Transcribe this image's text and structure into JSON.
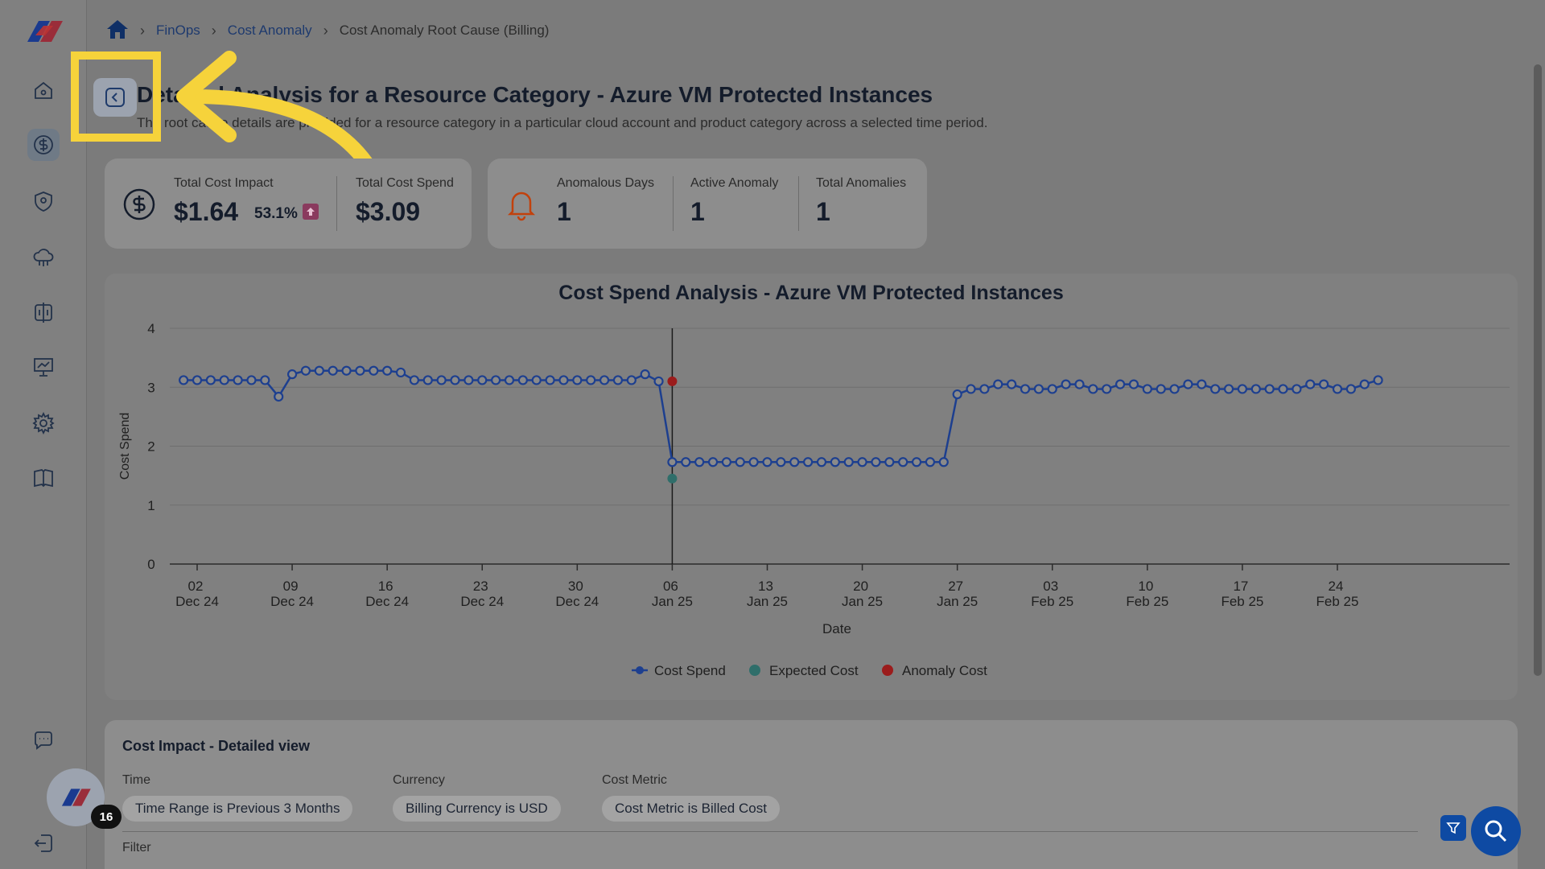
{
  "breadcrumb": {
    "items": [
      "FinOps",
      "Cost Anomaly"
    ],
    "current": "Cost Anomaly Root Cause (Billing)"
  },
  "header": {
    "title": "Detailed Analysis for a Resource Category - Azure VM Protected Instances",
    "subtitle": "The root cause details are provided for a resource category in a particular cloud account and product category across a selected time period."
  },
  "kpis": {
    "total_cost_impact_label": "Total Cost Impact",
    "total_cost_impact_value": "$1.64",
    "impact_percent": "53.1%",
    "total_cost_spend_label": "Total Cost Spend",
    "total_cost_spend_value": "$3.09",
    "anomalous_days_label": "Anomalous Days",
    "anomalous_days_value": "1",
    "active_anomaly_label": "Active Anomaly",
    "active_anomaly_value": "1",
    "total_anomalies_label": "Total Anomalies",
    "total_anomalies_value": "1"
  },
  "chart_data": {
    "type": "line",
    "title": "Cost Spend Analysis - Azure VM Protected Instances",
    "xlabel": "Date",
    "ylabel": "Cost Spend",
    "ylim": [
      0,
      4
    ],
    "yticks": [
      0,
      1,
      2,
      3,
      4
    ],
    "xticks": [
      {
        "day": 0,
        "l1": "02",
        "l2": "Dec 24"
      },
      {
        "day": 7,
        "l1": "09",
        "l2": "Dec 24"
      },
      {
        "day": 14,
        "l1": "16",
        "l2": "Dec 24"
      },
      {
        "day": 21,
        "l1": "23",
        "l2": "Dec 24"
      },
      {
        "day": 28,
        "l1": "30",
        "l2": "Dec 24"
      },
      {
        "day": 35,
        "l1": "06",
        "l2": "Jan 25"
      },
      {
        "day": 42,
        "l1": "13",
        "l2": "Jan 25"
      },
      {
        "day": 49,
        "l1": "20",
        "l2": "Jan 25"
      },
      {
        "day": 56,
        "l1": "27",
        "l2": "Jan 25"
      },
      {
        "day": 63,
        "l1": "03",
        "l2": "Feb 25"
      },
      {
        "day": 70,
        "l1": "10",
        "l2": "Feb 25"
      },
      {
        "day": 77,
        "l1": "17",
        "l2": "Feb 25"
      },
      {
        "day": 84,
        "l1": "24",
        "l2": "Feb 25"
      }
    ],
    "series": [
      {
        "name": "Cost Spend",
        "color": "#1d3f8f",
        "start_day": -1,
        "values": [
          3.12,
          3.12,
          3.12,
          3.12,
          3.12,
          3.12,
          3.12,
          2.84,
          3.22,
          3.28,
          3.28,
          3.28,
          3.28,
          3.28,
          3.28,
          3.28,
          3.25,
          3.12,
          3.12,
          3.12,
          3.12,
          3.12,
          3.12,
          3.12,
          3.12,
          3.12,
          3.12,
          3.12,
          3.12,
          3.12,
          3.12,
          3.12,
          3.12,
          3.12,
          3.22,
          3.1,
          1.73,
          1.73,
          1.73,
          1.73,
          1.73,
          1.73,
          1.73,
          1.73,
          1.73,
          1.73,
          1.73,
          1.73,
          1.73,
          1.73,
          1.73,
          1.73,
          1.73,
          1.73,
          1.73,
          1.73,
          1.73,
          2.88,
          2.97,
          2.97,
          3.05,
          3.05,
          2.97,
          2.97,
          2.97,
          3.05,
          3.05,
          2.97,
          2.97,
          3.05,
          3.05,
          2.97,
          2.97,
          2.97,
          3.05,
          3.05,
          2.97,
          2.97,
          2.97,
          2.97,
          2.97,
          2.97,
          2.97,
          3.05,
          3.05,
          2.97,
          2.97,
          3.05,
          3.12
        ]
      },
      {
        "name": "Expected Cost",
        "color": "#2f6e6a",
        "points": [
          {
            "day": 35,
            "value": 1.45
          }
        ]
      },
      {
        "name": "Anomaly Cost",
        "color": "#9b1c1c",
        "points": [
          {
            "day": 35,
            "value": 3.1
          }
        ]
      }
    ],
    "anomaly_marker_day": 35,
    "legend_position": "bottom-center"
  },
  "detail": {
    "title": "Cost Impact - Detailed view",
    "time_label": "Time",
    "time_chip": "Time Range is Previous 3 Months",
    "currency_label": "Currency",
    "currency_chip": "Billing Currency is USD",
    "metric_label": "Cost Metric",
    "metric_chip": "Cost Metric is Billed Cost",
    "filter_label": "Filter"
  },
  "notifications": {
    "count": "16"
  },
  "colors": {
    "accent": "#0e4aa3",
    "highlight": "#f6d33b",
    "anomaly": "#9b1c1c"
  }
}
